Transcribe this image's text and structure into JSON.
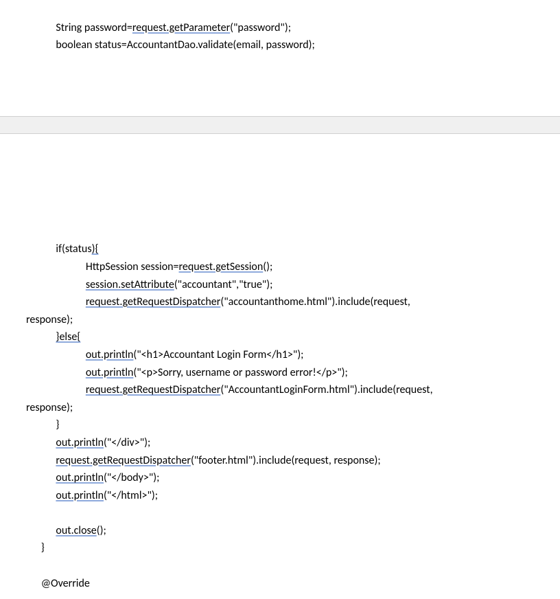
{
  "code": {
    "line1a": "            String password=",
    "line1b": "request.getParameter",
    "line1c": "(\"password\");",
    "line2": "            boolean status=AccountantDao.validate(email, password);",
    "line3a": "            if(status",
    "line3b": "){",
    "line4a": "                        HttpSession session=",
    "line4b": "request.getSession",
    "line4c": "();",
    "line5a": "                        ",
    "line5b": "session.setAttribute",
    "line5c": "(\"accountant\",\"true\");",
    "line6a": "                        ",
    "line6b": "request.getRequestDispatcher",
    "line6c": "(\"accountanthome.html\").include(request, ",
    "line7": "response);",
    "line8a": "            ",
    "line8b": "}else{",
    "line9a": "                        ",
    "line9b": "out.println",
    "line9c": "(\"<h1>Accountant Login Form</h1>\");",
    "line10a": "                        ",
    "line10b": "out.println",
    "line10c": "(\"<p>Sorry, username or password error!</p>\");",
    "line11a": "                        ",
    "line11b": "request.getRequestDispatcher",
    "line11c": "(\"AccountantLoginForm.html\").include(request, ",
    "line12": "response);",
    "line13": "            }",
    "line14a": "            ",
    "line14b": "out.println",
    "line14c": "(\"</div>\");",
    "line15a": "            ",
    "line15b": "request.getRequestDispatcher",
    "line15c": "(\"footer.html\").include(request, response);",
    "line16a": "            ",
    "line16b": "out.println",
    "line16c": "(\"</body>\");",
    "line17a": "            ",
    "line17b": "out.println",
    "line17c": "(\"</html>\");",
    "line18": "            ",
    "line19a": "            ",
    "line19b": "out.close",
    "line19c": "();",
    "line20": "      }",
    "line21": " ",
    "line22": "      @Override"
  }
}
